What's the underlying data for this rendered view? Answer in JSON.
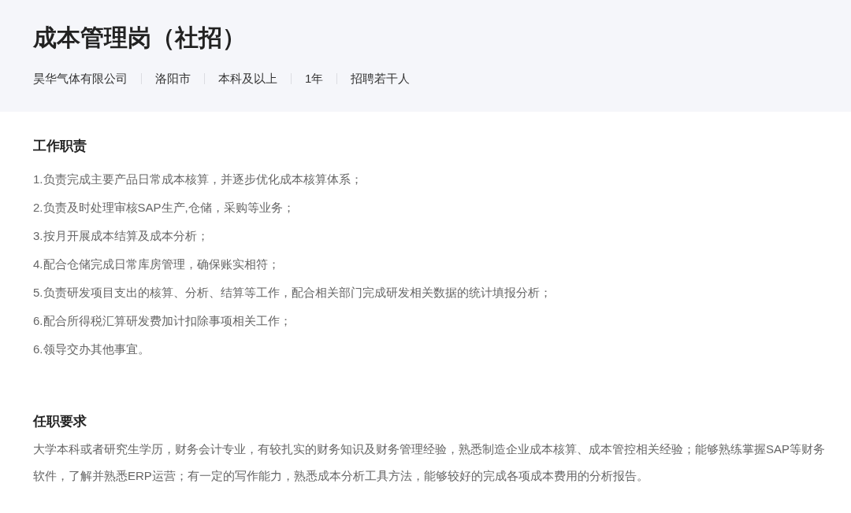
{
  "header": {
    "title": "成本管理岗（社招）",
    "meta": [
      "昊华气体有限公司",
      "洛阳市",
      "本科及以上",
      "1年",
      "招聘若干人"
    ]
  },
  "sections": [
    {
      "kind": "list",
      "heading": "工作职责",
      "items": [
        "1.负责完成主要产品日常成本核算，并逐步优化成本核算体系；",
        "2.负责及时处理审核SAP生产,仓储，采购等业务；",
        "3.按月开展成本结算及成本分析；",
        "4.配合仓储完成日常库房管理，确保账实相符；",
        "5.负责研发项目支出的核算、分析、结算等工作，配合相关部门完成研发相关数据的统计填报分析；",
        "6.配合所得税汇算研发费加计扣除事项相关工作；",
        "6.领导交办其他事宜。"
      ]
    },
    {
      "kind": "paragraph",
      "heading": "任职要求",
      "text": "大学本科或者研究生学历，财务会计专业，有较扎实的财务知识及财务管理经验，熟悉制造企业成本核算、成本管控相关经验；能够熟练掌握SAP等财务软件，了解并熟悉ERP运营；有一定的写作能力，熟悉成本分析工具方法，能够较好的完成各项成本费用的分析报告。"
    }
  ]
}
